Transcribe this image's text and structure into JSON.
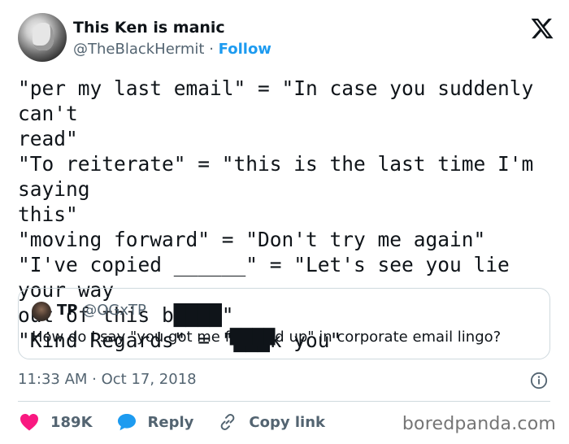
{
  "author": {
    "display_name": "This Ken is manic",
    "handle": "@TheBlackHermit",
    "separator": "·",
    "follow_label": "Follow"
  },
  "tweet": {
    "text": "\"per my last email\" = \"In case you suddenly can't\nread\"\n\"To reiterate\" = \"this is the last time I'm saying\nthis\"\n\"moving forward\" = \"Don't try me again\"\n\"I've copied ______\" = \"Let's see you lie your way\nout of this b████\"\n\"Kind Regards\" = \"███k you\"",
    "timestamp": "11:33 AM · Oct 17, 2018"
  },
  "quoted_tweet": {
    "display_name": "TP",
    "handle": "@OGxTP",
    "text": "How do I say \"you got me f████d up\" in corporate email lingo?"
  },
  "actions": {
    "likes_count": "189K",
    "reply_label": "Reply",
    "copy_link_label": "Copy link"
  },
  "watermark": "boredpanda.com",
  "colors": {
    "link_blue": "#1d9bf0",
    "like_red": "#f91880",
    "secondary_text": "#536471",
    "border": "#cfd9de"
  },
  "icons": [
    "x-logo-icon",
    "info-icon",
    "heart-icon",
    "reply-bubble-icon",
    "link-icon"
  ]
}
